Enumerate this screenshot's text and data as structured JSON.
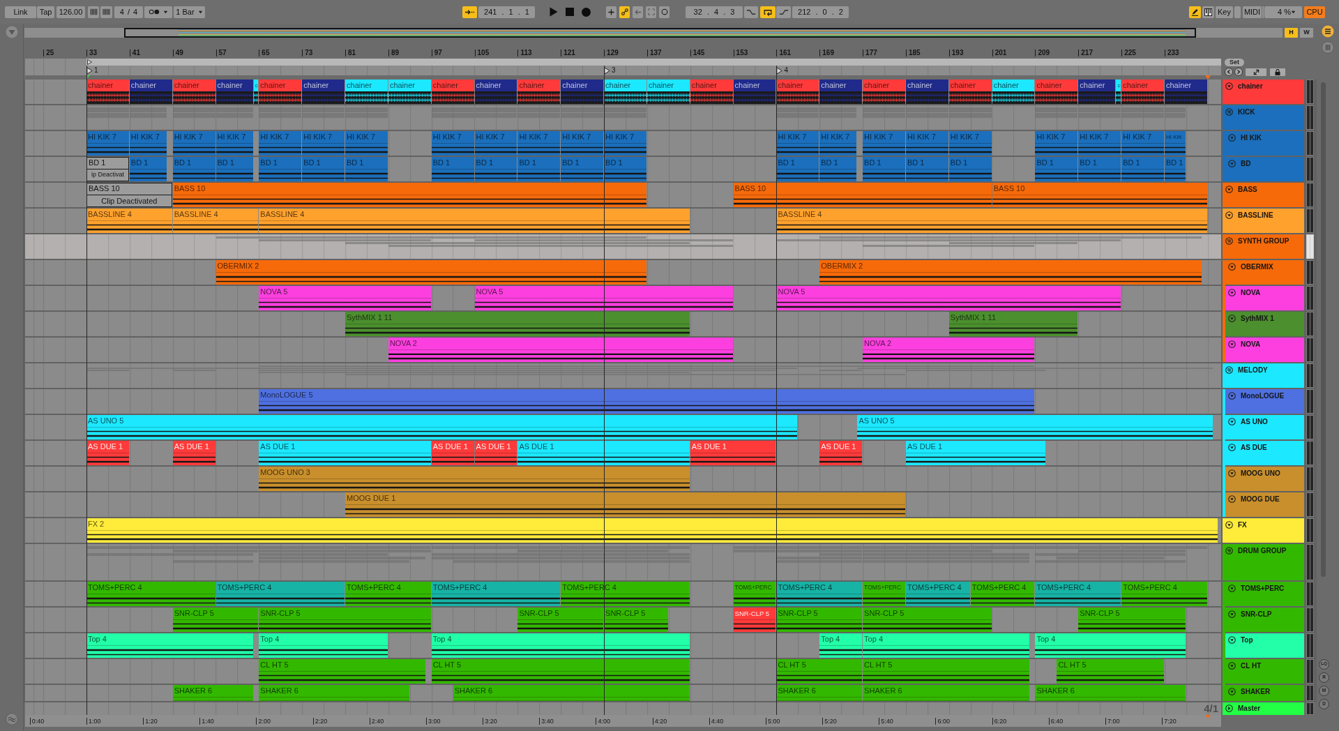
{
  "toolbar": {
    "link": "Link",
    "tap": "Tap",
    "tempo": "126.00",
    "time_signature": "4 / 4",
    "quantization": "1 Bar",
    "follow_on": true,
    "position": "241 . 1 . 1",
    "automation_arm_on": true,
    "loop_start": "32 . 4 . 3",
    "loop_on": true,
    "loop_length": "212 . 0 . 2",
    "draw_mode_on": true,
    "key": "Key",
    "midi": "MIDI",
    "cpu_load": "4 %",
    "cpu": "CPU",
    "cpu_overload": true
  },
  "overview": {
    "buttons": [
      {
        "label": "H",
        "on": true
      },
      {
        "label": "W",
        "on": false
      }
    ]
  },
  "ruler": {
    "bars": [
      "25",
      "33",
      "41",
      "49",
      "57",
      "65",
      "73",
      "81",
      "89",
      "97",
      "105",
      "113",
      "121",
      "129",
      "137",
      "145",
      "153",
      "161",
      "169",
      "177",
      "185",
      "193",
      "201",
      "209",
      "217",
      "225",
      "233"
    ],
    "set": "Set",
    "locators": [
      {
        "label": "1"
      },
      {
        "label": "3"
      },
      {
        "label": "4"
      }
    ]
  },
  "tracks": [
    {
      "name": "chainer",
      "kind": "audio",
      "color": "#ff3a3a",
      "selected": false,
      "expanded": true,
      "dense_waveform": true,
      "clips": [
        {
          "name": "chainer",
          "color": "#ff3a3a",
          "active": true
        },
        {
          "name": "chainer",
          "color": "#1f2a8a",
          "active": true
        },
        {
          "name": "chainer",
          "color": "#ff3a3a",
          "active": true
        },
        {
          "name": "chainer",
          "color": "#1f2a8a",
          "active": true
        },
        {
          "name": "c",
          "color": "#1ce8ff",
          "active": true
        },
        {
          "name": "chainer",
          "color": "#ff3a3a",
          "active": true
        },
        {
          "name": "chainer",
          "color": "#1f2a8a",
          "active": true
        },
        {
          "name": "chainer",
          "color": "#1ce8ff",
          "active": true
        },
        {
          "name": "chainer",
          "color": "#1ce8ff",
          "active": true
        },
        {
          "name": "chainer",
          "color": "#ff3a3a",
          "active": true
        },
        {
          "name": "chainer",
          "color": "#1f2a8a",
          "active": true
        },
        {
          "name": "chainer",
          "color": "#ff3a3a",
          "active": true
        },
        {
          "name": "chainer",
          "color": "#1f2a8a",
          "active": true
        },
        {
          "name": "chainer",
          "color": "#1ce8ff",
          "active": true
        },
        {
          "name": "chainer",
          "color": "#1ce8ff",
          "active": true
        },
        {
          "name": "chainer",
          "color": "#ff3a3a",
          "active": true
        },
        {
          "name": "chainer",
          "color": "#1f2a8a",
          "active": true
        },
        {
          "name": "chainer",
          "color": "#ff3a3a",
          "active": true
        },
        {
          "name": "chainer",
          "color": "#1f2a8a",
          "active": true
        },
        {
          "name": "chainer",
          "color": "#ff3a3a",
          "active": true
        },
        {
          "name": "chainer",
          "color": "#1f2a8a",
          "active": true
        },
        {
          "name": "chainer",
          "color": "#ff3a3a",
          "active": true
        },
        {
          "name": "chainer",
          "color": "#1ce8ff",
          "active": true
        },
        {
          "name": "chainer",
          "color": "#ff3a3a",
          "active": true
        },
        {
          "name": "chainer",
          "color": "#1f2a8a",
          "active": true
        },
        {
          "name": "c",
          "color": "#1ce8ff",
          "active": true
        },
        {
          "name": "chainer",
          "color": "#ff3a3a",
          "active": true
        },
        {
          "name": "chainer",
          "color": "#1f2a8a",
          "active": true
        }
      ]
    },
    {
      "name": "KICK",
      "kind": "group",
      "color": "#1b6fbc",
      "selected": false,
      "expanded": true,
      "children": [
        {
          "name": "HI KIK",
          "kind": "audio",
          "color": "#1b6fbc",
          "selected": false,
          "expanded": true,
          "clips": [
            {
              "name": "HI KIK 7",
              "active": true
            },
            {
              "name": "HI KIK 7",
              "active": true
            },
            {
              "name": "HI KIK 7",
              "active": true
            },
            {
              "name": "HI KIK 7",
              "active": true
            },
            {
              "name": "HI KIK 7",
              "active": true
            },
            {
              "name": "HI KIK 7",
              "active": true
            },
            {
              "name": "HI KIK 7",
              "active": true
            },
            {
              "name": "HI KIK 7",
              "active": true
            },
            {
              "name": "HI KIK 7",
              "active": true
            },
            {
              "name": "HI KIK 7",
              "active": true
            },
            {
              "name": "HI KIK 7",
              "active": true
            },
            {
              "name": "HI KIK 7",
              "active": true
            },
            {
              "name": "HI KIK 7",
              "active": true
            },
            {
              "name": "HI KIK 7",
              "active": true
            },
            {
              "name": "HI KIK 7",
              "active": true
            },
            {
              "name": "HI KIK 7",
              "active": true
            },
            {
              "name": "HI KIK 7",
              "active": true
            },
            {
              "name": "HI KIK 7",
              "active": true
            },
            {
              "name": "HI KIK 7",
              "active": true
            },
            {
              "name": "HI KIK 7",
              "active": true
            },
            {
              "name": "HI KIK",
              "active": true
            }
          ]
        },
        {
          "name": "BD",
          "kind": "audio",
          "color": "#1b6fbc",
          "selected": false,
          "expanded": true,
          "clips": [
            {
              "name": "BD 1",
              "active": false,
              "notice": "ip Deactivat"
            },
            {
              "name": "BD 1",
              "active": true
            },
            {
              "name": "BD 1",
              "active": true
            },
            {
              "name": "BD 1",
              "active": true
            },
            {
              "name": "BD 1",
              "active": true
            },
            {
              "name": "BD 1",
              "active": true
            },
            {
              "name": "BD 1",
              "active": true
            },
            {
              "name": "BD 1",
              "active": true
            },
            {
              "name": "BD 1",
              "active": true
            },
            {
              "name": "BD 1",
              "active": true
            },
            {
              "name": "BD 1",
              "active": true
            },
            {
              "name": "BD 1",
              "active": true
            },
            {
              "name": "BD 1",
              "active": true
            },
            {
              "name": "BD 1",
              "active": true
            },
            {
              "name": "BD 1",
              "active": true
            },
            {
              "name": "BD 1",
              "active": true
            },
            {
              "name": "BD 1",
              "active": true
            },
            {
              "name": "BD 1",
              "active": true
            },
            {
              "name": "BD 1",
              "active": true
            },
            {
              "name": "BD 1",
              "active": true
            },
            {
              "name": "BD 1",
              "active": true
            }
          ]
        }
      ]
    },
    {
      "name": "BASS",
      "kind": "audio",
      "color": "#f66a0a",
      "selected": false,
      "expanded": true,
      "clips": [
        {
          "name": "BASS 10",
          "active": false,
          "notice": "Clip Deactivated"
        },
        {
          "name": "BASS 10",
          "active": true
        },
        {
          "name": "BASS 10",
          "active": true
        },
        {
          "name": "BASS 10",
          "active": true
        }
      ]
    },
    {
      "name": "BASSLINE",
      "kind": "audio",
      "color": "#ffa12d",
      "selected": false,
      "expanded": true,
      "clips": [
        {
          "name": "BASSLINE 4",
          "active": true
        },
        {
          "name": "BASSLINE 4",
          "active": true
        },
        {
          "name": "BASSLINE 4",
          "active": true
        },
        {
          "name": "BASSLINE 4",
          "active": true
        }
      ]
    },
    {
      "name": "SYNTH GROUP",
      "kind": "group",
      "color": "#f66a0a",
      "selected": true,
      "expanded": true,
      "children": [
        {
          "name": "OBERMIX",
          "kind": "audio",
          "color": "#f66a0a",
          "selected": false,
          "expanded": true,
          "clips": [
            {
              "name": "OBERMIX 2",
              "active": true
            },
            {
              "name": "OBERMIX 2",
              "active": true
            }
          ]
        },
        {
          "name": "NOVA",
          "kind": "audio",
          "color": "#fd3fdf",
          "selected": false,
          "expanded": true,
          "clips": [
            {
              "name": "NOVA 5",
              "active": true
            },
            {
              "name": "NOVA 5",
              "active": true
            },
            {
              "name": "NOVA 5",
              "active": true
            }
          ]
        },
        {
          "name": "SythMIX 1",
          "kind": "audio",
          "color": "#4b8f2e",
          "selected": false,
          "expanded": true,
          "clips": [
            {
              "name": "SythMIX 1 11",
              "active": true
            },
            {
              "name": "SythMIX 1 11",
              "active": true
            }
          ]
        },
        {
          "name": "NOVA",
          "kind": "audio",
          "color": "#fd3fdf",
          "selected": false,
          "expanded": true,
          "clips": [
            {
              "name": "NOVA 2",
              "active": true
            },
            {
              "name": "NOVA 2",
              "active": true
            }
          ]
        }
      ]
    },
    {
      "name": "MELODY",
      "kind": "group",
      "color": "#1ce8ff",
      "selected": false,
      "expanded": true,
      "children": [
        {
          "name": "MonoLOGUE",
          "kind": "audio",
          "color": "#4f70e0",
          "selected": false,
          "expanded": true,
          "clips": [
            {
              "name": "MonoLOGUE 5",
              "active": true
            }
          ]
        },
        {
          "name": "AS UNO",
          "kind": "audio",
          "color": "#1ce8ff",
          "selected": false,
          "expanded": true,
          "clips": [
            {
              "name": "AS UNO 5",
              "active": true
            },
            {
              "name": "AS UNO 5",
              "active": true
            }
          ]
        },
        {
          "name": "AS DUE",
          "kind": "audio",
          "color": "#1ce8ff",
          "selected": false,
          "expanded": true,
          "clips": [
            {
              "name": "AS DUE 1",
              "color": "#ff3a3a",
              "active": true
            },
            {
              "name": "AS DUE 1",
              "color": "#ff3a3a",
              "active": true
            },
            {
              "name": "AS DUE 1",
              "color": "#1ce8ff",
              "active": true
            },
            {
              "name": "AS DUE 1",
              "color": "#ff3a3a",
              "active": true
            },
            {
              "name": "AS DUE 1",
              "color": "#ff3a3a",
              "active": true
            },
            {
              "name": "AS DUE 1",
              "color": "#1ce8ff",
              "active": true
            },
            {
              "name": "AS DUE 1",
              "color": "#ff3a3a",
              "active": true
            },
            {
              "name": "AS DUE 1",
              "color": "#ff3a3a",
              "active": true
            },
            {
              "name": "AS DUE 1",
              "color": "#1ce8ff",
              "active": true
            }
          ]
        },
        {
          "name": "MOOG UNO",
          "kind": "audio",
          "color": "#c88f2c",
          "selected": false,
          "expanded": true,
          "clips": [
            {
              "name": "MOOG UNO 3",
              "active": true
            }
          ]
        },
        {
          "name": "MOOG DUE",
          "kind": "audio",
          "color": "#c88f2c",
          "selected": false,
          "expanded": true,
          "clips": [
            {
              "name": "MOOG DUE 1",
              "active": true
            }
          ]
        }
      ]
    },
    {
      "name": "FX",
      "kind": "audio",
      "color": "#ffeb3a",
      "selected": false,
      "expanded": true,
      "clips": [
        {
          "name": "FX 2",
          "active": true
        }
      ]
    },
    {
      "name": "DRUM GROUP",
      "kind": "group",
      "color": "#33b800",
      "selected": false,
      "expanded": true,
      "children": [
        {
          "name": "TOMS+PERC",
          "kind": "audio",
          "color": "#33b800",
          "selected": false,
          "expanded": true,
          "clips": [
            {
              "name": "TOMS+PERC 4",
              "color": "#33b800",
              "active": true
            },
            {
              "name": "TOMS+PERC 4",
              "color": "#17b3a5",
              "active": true
            },
            {
              "name": "TOMS+PERC 4",
              "color": "#33b800",
              "active": true
            },
            {
              "name": "TOMS+PERC 4",
              "color": "#17b3a5",
              "active": true
            },
            {
              "name": "TOMS+PERC 4",
              "color": "#33b800",
              "active": true
            },
            {
              "name": "TOMS+PERC",
              "color": "#33b800",
              "active": true
            },
            {
              "name": "TOMS+PERC 4",
              "color": "#17b3a5",
              "active": true
            },
            {
              "name": "TOMS+PERC",
              "color": "#33b800",
              "active": true
            },
            {
              "name": "TOMS+PERC 4",
              "color": "#17b3a5",
              "active": true
            },
            {
              "name": "TOMS+PERC 4",
              "color": "#33b800",
              "active": true
            },
            {
              "name": "TOMS+PERC 4",
              "color": "#17b3a5",
              "active": true
            },
            {
              "name": "TOMS+PERC 4",
              "color": "#33b800",
              "active": true
            }
          ]
        },
        {
          "name": "SNR-CLP",
          "kind": "audio",
          "color": "#33b800",
          "selected": false,
          "expanded": true,
          "clips": [
            {
              "name": "SNR-CLP 5",
              "color": "#33b800",
              "active": true
            },
            {
              "name": "SNR-CLP 5",
              "color": "#33b800",
              "active": true
            },
            {
              "name": "SNR-CLP 5",
              "color": "#33b800",
              "active": true
            },
            {
              "name": "SNR-CLP 5",
              "color": "#33b800",
              "active": true
            },
            {
              "name": "SNR-CLP 5",
              "color": "#ff3a3a",
              "active": true
            },
            {
              "name": "SNR-CLP 5",
              "color": "#33b800",
              "active": true
            },
            {
              "name": "SNR-CLP 5",
              "color": "#33b800",
              "active": true
            },
            {
              "name": "SNR-CLP 5",
              "color": "#33b800",
              "active": true
            }
          ]
        },
        {
          "name": "Top",
          "kind": "audio",
          "color": "#22ffa8",
          "selected": false,
          "expanded": true,
          "clips": [
            {
              "name": "Top 4",
              "active": true
            },
            {
              "name": "Top 4",
              "active": true
            },
            {
              "name": "Top 4",
              "active": true
            },
            {
              "name": "Top 4",
              "active": true
            },
            {
              "name": "Top 4",
              "active": true
            },
            {
              "name": "Top 4",
              "active": true
            }
          ]
        },
        {
          "name": "CL HT",
          "kind": "audio",
          "color": "#33b800",
          "selected": false,
          "expanded": true,
          "clips": [
            {
              "name": "CL HT 5",
              "active": true
            },
            {
              "name": "CL HT 5",
              "active": true
            },
            {
              "name": "CL HT 5",
              "active": true
            },
            {
              "name": "CL HT 5",
              "active": true
            },
            {
              "name": "CL HT 5",
              "active": true
            }
          ]
        },
        {
          "name": "SHAKER",
          "kind": "audio",
          "color": "#33b800",
          "selected": false,
          "expanded": true,
          "clips": [
            {
              "name": "SHAKER 6",
              "active": true
            },
            {
              "name": "SHAKER 6",
              "active": true
            },
            {
              "name": "SHAKER 6",
              "active": true
            },
            {
              "name": "SHAKER 6",
              "active": true
            },
            {
              "name": "SHAKER 6",
              "active": true
            },
            {
              "name": "SHAKER 6",
              "active": true
            }
          ]
        }
      ]
    },
    {
      "name": "Master",
      "kind": "master",
      "color": "#22ff44",
      "selected": false,
      "expanded": false
    }
  ],
  "time_ruler": {
    "times": [
      "0:40",
      "1:00",
      "1:20",
      "1:40",
      "2:00",
      "2:20",
      "2:40",
      "3:00",
      "3:20",
      "3:40",
      "4:00",
      "4:20",
      "4:40",
      "5:00",
      "5:20",
      "5:40",
      "6:00",
      "6:20",
      "6:40",
      "7:00",
      "7:20"
    ],
    "grid": "4/1"
  },
  "side_buttons": [
    "I-O",
    "R",
    "M",
    "D"
  ]
}
